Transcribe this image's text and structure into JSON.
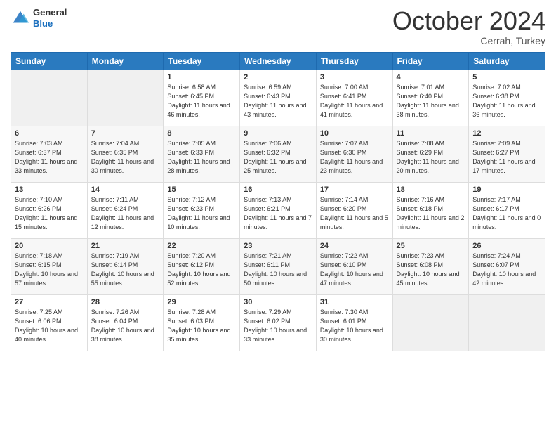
{
  "logo": {
    "general": "General",
    "blue": "Blue"
  },
  "header": {
    "month": "October 2024",
    "location": "Cerrah, Turkey"
  },
  "weekdays": [
    "Sunday",
    "Monday",
    "Tuesday",
    "Wednesday",
    "Thursday",
    "Friday",
    "Saturday"
  ],
  "weeks": [
    [
      null,
      null,
      {
        "day": 1,
        "sunrise": "6:58 AM",
        "sunset": "6:45 PM",
        "daylight": "11 hours and 46 minutes."
      },
      {
        "day": 2,
        "sunrise": "6:59 AM",
        "sunset": "6:43 PM",
        "daylight": "11 hours and 43 minutes."
      },
      {
        "day": 3,
        "sunrise": "7:00 AM",
        "sunset": "6:41 PM",
        "daylight": "11 hours and 41 minutes."
      },
      {
        "day": 4,
        "sunrise": "7:01 AM",
        "sunset": "6:40 PM",
        "daylight": "11 hours and 38 minutes."
      },
      {
        "day": 5,
        "sunrise": "7:02 AM",
        "sunset": "6:38 PM",
        "daylight": "11 hours and 36 minutes."
      }
    ],
    [
      {
        "day": 6,
        "sunrise": "7:03 AM",
        "sunset": "6:37 PM",
        "daylight": "11 hours and 33 minutes."
      },
      {
        "day": 7,
        "sunrise": "7:04 AM",
        "sunset": "6:35 PM",
        "daylight": "11 hours and 30 minutes."
      },
      {
        "day": 8,
        "sunrise": "7:05 AM",
        "sunset": "6:33 PM",
        "daylight": "11 hours and 28 minutes."
      },
      {
        "day": 9,
        "sunrise": "7:06 AM",
        "sunset": "6:32 PM",
        "daylight": "11 hours and 25 minutes."
      },
      {
        "day": 10,
        "sunrise": "7:07 AM",
        "sunset": "6:30 PM",
        "daylight": "11 hours and 23 minutes."
      },
      {
        "day": 11,
        "sunrise": "7:08 AM",
        "sunset": "6:29 PM",
        "daylight": "11 hours and 20 minutes."
      },
      {
        "day": 12,
        "sunrise": "7:09 AM",
        "sunset": "6:27 PM",
        "daylight": "11 hours and 17 minutes."
      }
    ],
    [
      {
        "day": 13,
        "sunrise": "7:10 AM",
        "sunset": "6:26 PM",
        "daylight": "11 hours and 15 minutes."
      },
      {
        "day": 14,
        "sunrise": "7:11 AM",
        "sunset": "6:24 PM",
        "daylight": "11 hours and 12 minutes."
      },
      {
        "day": 15,
        "sunrise": "7:12 AM",
        "sunset": "6:23 PM",
        "daylight": "11 hours and 10 minutes."
      },
      {
        "day": 16,
        "sunrise": "7:13 AM",
        "sunset": "6:21 PM",
        "daylight": "11 hours and 7 minutes."
      },
      {
        "day": 17,
        "sunrise": "7:14 AM",
        "sunset": "6:20 PM",
        "daylight": "11 hours and 5 minutes."
      },
      {
        "day": 18,
        "sunrise": "7:16 AM",
        "sunset": "6:18 PM",
        "daylight": "11 hours and 2 minutes."
      },
      {
        "day": 19,
        "sunrise": "7:17 AM",
        "sunset": "6:17 PM",
        "daylight": "11 hours and 0 minutes."
      }
    ],
    [
      {
        "day": 20,
        "sunrise": "7:18 AM",
        "sunset": "6:15 PM",
        "daylight": "10 hours and 57 minutes."
      },
      {
        "day": 21,
        "sunrise": "7:19 AM",
        "sunset": "6:14 PM",
        "daylight": "10 hours and 55 minutes."
      },
      {
        "day": 22,
        "sunrise": "7:20 AM",
        "sunset": "6:12 PM",
        "daylight": "10 hours and 52 minutes."
      },
      {
        "day": 23,
        "sunrise": "7:21 AM",
        "sunset": "6:11 PM",
        "daylight": "10 hours and 50 minutes."
      },
      {
        "day": 24,
        "sunrise": "7:22 AM",
        "sunset": "6:10 PM",
        "daylight": "10 hours and 47 minutes."
      },
      {
        "day": 25,
        "sunrise": "7:23 AM",
        "sunset": "6:08 PM",
        "daylight": "10 hours and 45 minutes."
      },
      {
        "day": 26,
        "sunrise": "7:24 AM",
        "sunset": "6:07 PM",
        "daylight": "10 hours and 42 minutes."
      }
    ],
    [
      {
        "day": 27,
        "sunrise": "7:25 AM",
        "sunset": "6:06 PM",
        "daylight": "10 hours and 40 minutes."
      },
      {
        "day": 28,
        "sunrise": "7:26 AM",
        "sunset": "6:04 PM",
        "daylight": "10 hours and 38 minutes."
      },
      {
        "day": 29,
        "sunrise": "7:28 AM",
        "sunset": "6:03 PM",
        "daylight": "10 hours and 35 minutes."
      },
      {
        "day": 30,
        "sunrise": "7:29 AM",
        "sunset": "6:02 PM",
        "daylight": "10 hours and 33 minutes."
      },
      {
        "day": 31,
        "sunrise": "7:30 AM",
        "sunset": "6:01 PM",
        "daylight": "10 hours and 30 minutes."
      },
      null,
      null
    ]
  ],
  "labels": {
    "sunrise": "Sunrise:",
    "sunset": "Sunset:",
    "daylight": "Daylight:"
  }
}
